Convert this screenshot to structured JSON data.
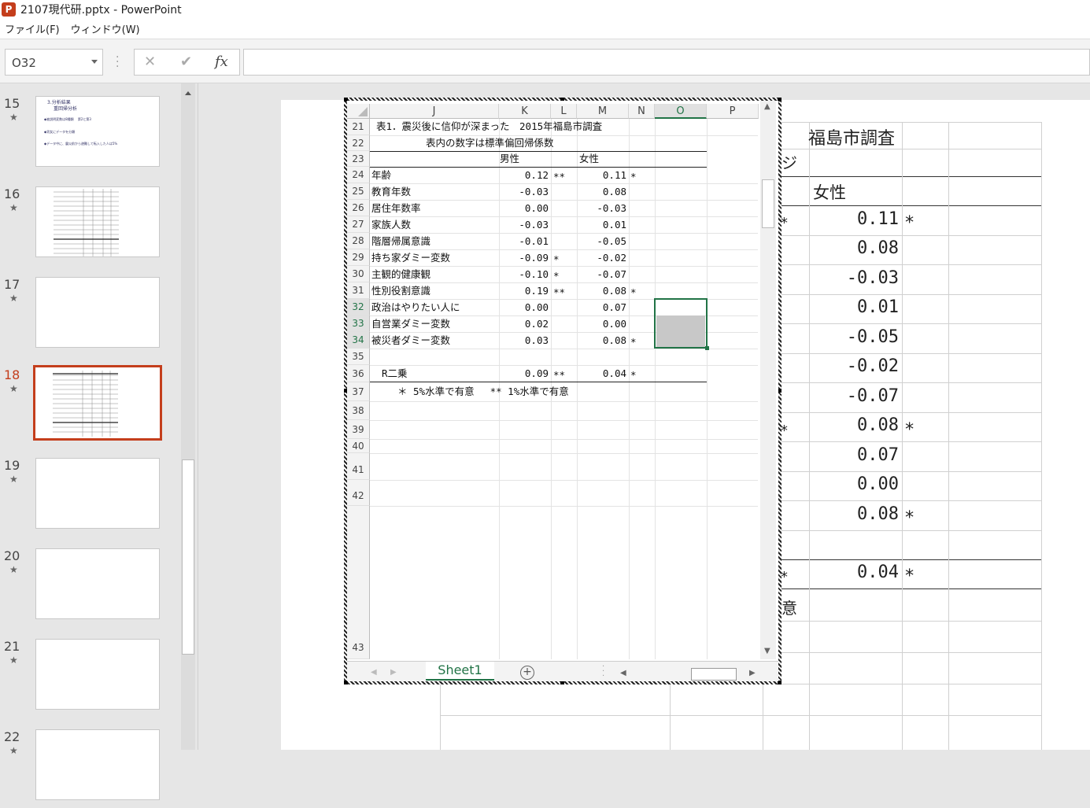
{
  "window": {
    "title": "2107現代研.pptx - PowerPoint",
    "app_icon": "P"
  },
  "menu": [
    "ファイル(F)",
    "ウィンドウ(W)"
  ],
  "formula_bar": {
    "name_box": "O32",
    "cancel": "✕",
    "enter": "✔",
    "fx": "fx",
    "formula": ""
  },
  "thumbnails": [
    {
      "num": "15",
      "star": "★"
    },
    {
      "num": "16",
      "star": "★"
    },
    {
      "num": "17",
      "star": "★"
    },
    {
      "num": "18",
      "star": "★"
    },
    {
      "num": "19",
      "star": "★"
    },
    {
      "num": "20",
      "star": "★"
    },
    {
      "num": "21",
      "star": "★"
    },
    {
      "num": "22",
      "star": "★"
    }
  ],
  "thumb15": {
    "heading1": "3.分析結果",
    "heading2": "重回帰分析",
    "bullet1": "◆被説明変数は8種類　 第2と第3",
    "bullet2": "◆男女にデータを分類",
    "bullet3": "◆データ中に、震災前から避難して転入した人は5%"
  },
  "slide_bg": {
    "title": "福島市調査",
    "sub": "ジ",
    "col_f": "女性",
    "vals": [
      "0.11",
      "0.08",
      "-0.03",
      "0.01",
      "-0.05",
      "-0.02",
      "-0.07",
      "0.08",
      "0.07",
      "0.00",
      "0.08",
      "",
      "0.04"
    ],
    "stars": [
      "*",
      "",
      "",
      "",
      "",
      "",
      "",
      "*",
      "",
      "",
      "*",
      "",
      "*"
    ],
    "left_marks": [
      "*",
      "*",
      "*"
    ],
    "note": "意"
  },
  "sheet": {
    "columns": [
      "J",
      "K",
      "L",
      "M",
      "N",
      "O",
      "P"
    ],
    "selected_column": "O",
    "rows": [
      "21",
      "22",
      "23",
      "24",
      "25",
      "26",
      "27",
      "28",
      "29",
      "30",
      "31",
      "32",
      "33",
      "34",
      "35",
      "36",
      "37",
      "38",
      "39",
      "40",
      "41",
      "42",
      "43"
    ],
    "title": "表1．震災後に信仰が深まった　2015年福島市調査",
    "subtitle": "表内の数字は標準偏回帰係数",
    "hdr_m": "男性",
    "hdr_f": "女性",
    "data": [
      {
        "label": "年齢",
        "m": "0.12",
        "ms": "**",
        "f": "0.11",
        "fs": "*"
      },
      {
        "label": "教育年数",
        "m": "-0.03",
        "ms": "",
        "f": "0.08",
        "fs": ""
      },
      {
        "label": "居住年数率",
        "m": "0.00",
        "ms": "",
        "f": "-0.03",
        "fs": ""
      },
      {
        "label": "家族人数",
        "m": "-0.03",
        "ms": "",
        "f": "0.01",
        "fs": ""
      },
      {
        "label": "階層帰属意識",
        "m": "-0.01",
        "ms": "",
        "f": "-0.05",
        "fs": ""
      },
      {
        "label": "持ち家ダミー変数",
        "m": "-0.09",
        "ms": "*",
        "f": "-0.02",
        "fs": ""
      },
      {
        "label": "主観的健康観",
        "m": "-0.10",
        "ms": "*",
        "f": "-0.07",
        "fs": ""
      },
      {
        "label": "性別役割意識",
        "m": "0.19",
        "ms": "**",
        "f": "0.08",
        "fs": "*"
      },
      {
        "label": "政治はやりたい人に",
        "m": "0.00",
        "ms": "",
        "f": "0.07",
        "fs": ""
      },
      {
        "label": "自営業ダミー変数",
        "m": "0.02",
        "ms": "",
        "f": "0.00",
        "fs": ""
      },
      {
        "label": "被災者ダミー変数",
        "m": "0.03",
        "ms": "",
        "f": "0.08",
        "fs": "*"
      }
    ],
    "r2": {
      "label": "R二乗",
      "m": "0.09",
      "ms": "**",
      "f": "0.04",
      "fs": "*"
    },
    "note": "＊ 5%水準で有意　 ** 1%水準で有意",
    "tab": "Sheet1",
    "add": "+"
  }
}
